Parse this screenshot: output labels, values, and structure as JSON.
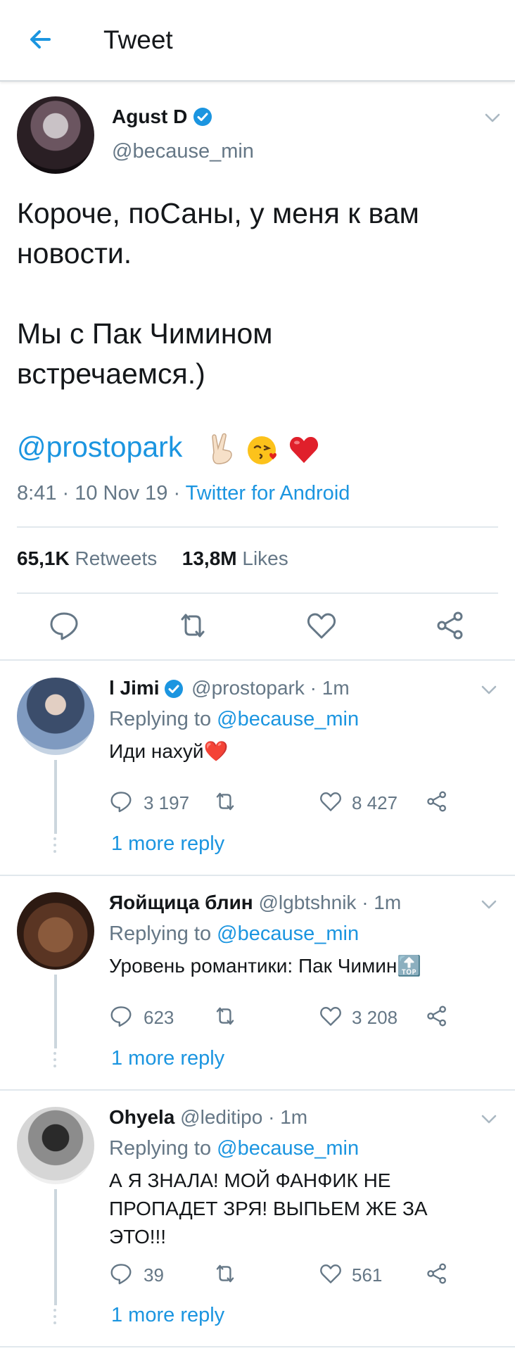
{
  "header": {
    "title": "Tweet"
  },
  "main_tweet": {
    "name": "Agust D",
    "handle": "@because_min",
    "text_line1": "Короче, поСаны, у меня к вам",
    "text_line2": "новости.",
    "text_line3": "Мы с Пак Чимином",
    "text_line4": "встречаемся.)",
    "mention": "@prostopark",
    "emojis": [
      "✌🏻",
      "😘",
      "❤️"
    ],
    "time": "8:41 · 10 Nov 19 · ",
    "source": "Twitter for Android",
    "retweets_count": "65,1K",
    "retweets_label": "Retweets",
    "likes_count": "13,8M",
    "likes_label": "Likes"
  },
  "replies": [
    {
      "name": "l Jimi",
      "verified": true,
      "handle": "@prostopark · 1m",
      "replying_prefix": "Replying to ",
      "replying_to": "@because_min",
      "text": "Иди нахуй❤️",
      "comments": "3 197",
      "likes": "8 427",
      "more": "1 more reply"
    },
    {
      "name": "Яойщица блин",
      "verified": false,
      "handle": "@lgbtshnik · 1m",
      "replying_prefix": "Replying to ",
      "replying_to": "@because_min",
      "text": "Уровень романтики: Пак Чимин🔝",
      "comments": "623",
      "likes": "3 208",
      "more": "1 more reply"
    },
    {
      "name": "Ohyela",
      "verified": false,
      "handle": "@leditipo · 1m",
      "replying_prefix": "Replying to ",
      "replying_to": "@because_min",
      "text_line1": "А Я ЗНАЛА! МОЙ ФАНФИК НЕ",
      "text_line2": "ПРОПАДЕТ ЗРЯ! ВЫПЬЕМ ЖЕ ЗА",
      "text_line3": "ЭТО!!!",
      "comments": "39",
      "likes": "561",
      "more": "1 more reply"
    }
  ],
  "colors": {
    "accent": "#1b95e0",
    "muted": "#657786",
    "divider": "#e1e8ed"
  }
}
